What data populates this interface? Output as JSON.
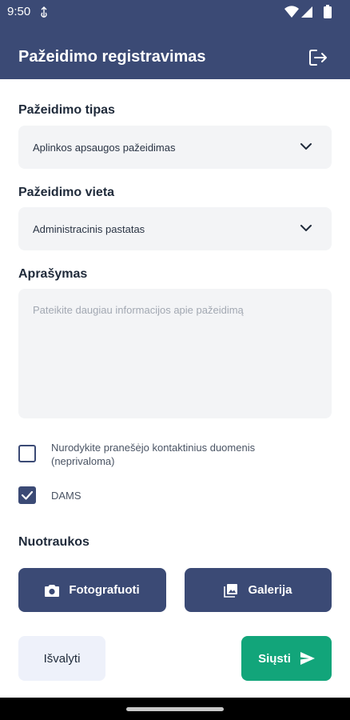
{
  "status_bar": {
    "time": "9:50"
  },
  "header": {
    "title": "Pažeidimo registravimas",
    "logout_icon": "logout-icon"
  },
  "form": {
    "type_label": "Pažeidimo tipas",
    "type_value": "Aplinkos apsaugos pažeidimas",
    "location_label": "Pažeidimo vieta",
    "location_value": "Administracinis pastatas",
    "description_label": "Aprašymas",
    "description_placeholder": "Pateikite daugiau informacijos apie pažeidimą",
    "description_value": "",
    "contact_checkbox": {
      "line1": "Nurodykite pranešėjo kontaktinius duomenis",
      "line2": "(neprivaloma)",
      "checked": false
    },
    "dams_checkbox": {
      "label": "DAMS",
      "checked": true
    }
  },
  "photos": {
    "label": "Nuotraukos",
    "camera_button": "Fotografuoti",
    "gallery_button": "Galerija"
  },
  "actions": {
    "clear_button": "Išvalyti",
    "send_button": "Siųsti"
  },
  "colors": {
    "primary": "#3b4a75",
    "send": "#12a57a",
    "field_bg": "#f3f4f6",
    "clear_bg": "#eef1fa"
  }
}
